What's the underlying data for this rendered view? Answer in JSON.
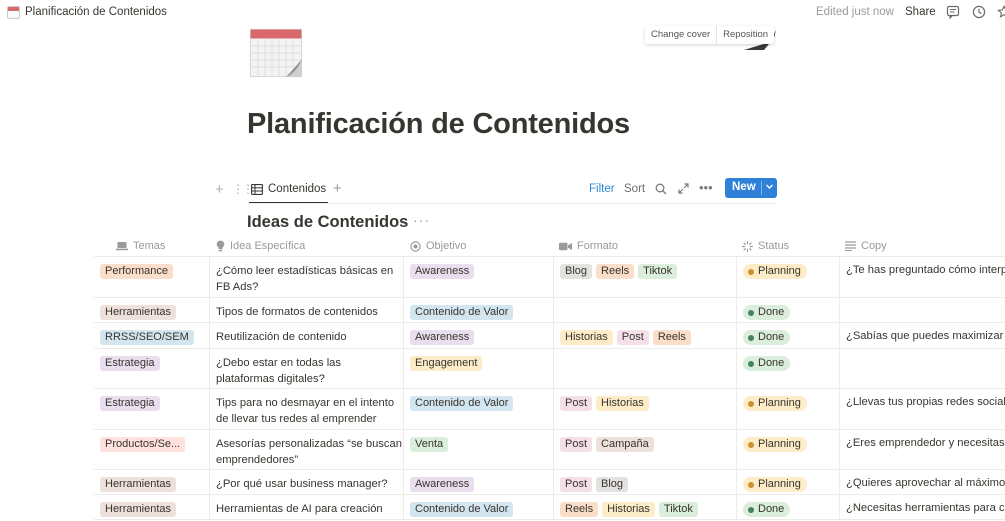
{
  "topbar": {
    "breadcrumb": "Planificación de Contenidos",
    "edited": "Edited just now",
    "share": "Share",
    "icons": [
      "comment-icon",
      "history-icon",
      "star-icon"
    ]
  },
  "cover": {
    "change_cover": "Change cover",
    "reposition": "Reposition"
  },
  "page": {
    "title": "Planificación de Contenidos",
    "icon": "calendar-icon"
  },
  "view": {
    "tab_label": "Contenidos",
    "filter": "Filter",
    "sort": "Sort",
    "new": "New"
  },
  "database": {
    "title": "Ideas de Contenidos"
  },
  "columns": [
    {
      "label": "Temas",
      "icon": "laptop-icon"
    },
    {
      "label": "Idea Específica",
      "icon": "lightbulb-icon"
    },
    {
      "label": "Objetivo",
      "icon": "target-icon"
    },
    {
      "label": "Formato",
      "icon": "video-icon"
    },
    {
      "label": "Status",
      "icon": "status-icon"
    },
    {
      "label": "Copy",
      "icon": "text-lines-icon"
    }
  ],
  "colors": {
    "orange": "#fadec9",
    "brown": "#eee0da",
    "blue": "#d3e5ef",
    "purple": "#e8deee",
    "yellow": "#fdecc8",
    "red": "#ffe2dd",
    "green": "#dbeddb",
    "gray": "#e3e2e0",
    "pink": "#f5e0e9",
    "planning_bg": "#fdecc8",
    "planning_dot": "#cb912f",
    "done_bg": "#dbeddb",
    "done_dot": "#448361"
  },
  "rows": [
    {
      "tema": {
        "label": "Performance",
        "color": "orange"
      },
      "idea": "¿Cómo leer estadísticas básicas en FB Ads?",
      "objetivo": {
        "label": "Awareness",
        "color": "purple"
      },
      "formato": [
        {
          "label": "Blog",
          "color": "gray"
        },
        {
          "label": "Reels",
          "color": "orange"
        },
        {
          "label": "Tiktok",
          "color": "green"
        }
      ],
      "status": "Planning",
      "copy": "¿Te has preguntado cómo interpretar"
    },
    {
      "tema": {
        "label": "Herramientas",
        "color": "brown"
      },
      "idea": "Tipos de formatos de contenidos",
      "objetivo": {
        "label": "Contenido de Valor",
        "color": "blue"
      },
      "formato": [],
      "status": "Done",
      "copy": ""
    },
    {
      "tema": {
        "label": "RRSS/SEO/SEM",
        "color": "blue"
      },
      "idea": "Reutilización de contenido",
      "objetivo": {
        "label": "Awareness",
        "color": "purple"
      },
      "formato": [
        {
          "label": "Historias",
          "color": "yellow"
        },
        {
          "label": "Post",
          "color": "pink"
        },
        {
          "label": "Reels",
          "color": "orange"
        }
      ],
      "status": "Done",
      "copy": "¿Sabías que puedes maximizar tu"
    },
    {
      "tema": {
        "label": "Estrategia",
        "color": "purple"
      },
      "idea": "¿Debo estar en todas las plataformas digitales?",
      "objetivo": {
        "label": "Engagement",
        "color": "yellow"
      },
      "formato": [],
      "status": "Done",
      "copy": ""
    },
    {
      "tema": {
        "label": "Estrategia",
        "color": "purple"
      },
      "idea": "Tips para no desmayar en el intento de llevar tus redes al emprender",
      "objetivo": {
        "label": "Contenido de Valor",
        "color": "blue"
      },
      "formato": [
        {
          "label": "Post",
          "color": "pink"
        },
        {
          "label": "Historias",
          "color": "yellow"
        }
      ],
      "status": "Planning",
      "copy": "¿Llevas tus propias redes sociales"
    },
    {
      "tema": {
        "label": "Productos/Se...",
        "color": "red"
      },
      "idea": "Asesorías personalizadas “se buscan emprendedores”",
      "objetivo": {
        "label": "Venta",
        "color": "green"
      },
      "formato": [
        {
          "label": "Post",
          "color": "pink"
        },
        {
          "label": "Campaña",
          "color": "brown"
        }
      ],
      "status": "Planning",
      "copy": "¿Eres emprendedor y necesitas a"
    },
    {
      "tema": {
        "label": "Herramientas",
        "color": "brown"
      },
      "idea": "¿Por qué usar business manager?",
      "objetivo": {
        "label": "Awareness",
        "color": "purple"
      },
      "formato": [
        {
          "label": "Post",
          "color": "pink"
        },
        {
          "label": "Blog",
          "color": "gray"
        }
      ],
      "status": "Planning",
      "copy": "¿Quieres aprovechar al máximo tu"
    },
    {
      "tema": {
        "label": "Herramientas",
        "color": "brown"
      },
      "idea": "Herramientas de AI para creación",
      "objetivo": {
        "label": "Contenido de Valor",
        "color": "blue"
      },
      "formato": [
        {
          "label": "Reels",
          "color": "orange"
        },
        {
          "label": "Historias",
          "color": "yellow"
        },
        {
          "label": "Tiktok",
          "color": "green"
        }
      ],
      "status": "Done",
      "copy": "¿Necesitas herramientas para crear"
    }
  ]
}
